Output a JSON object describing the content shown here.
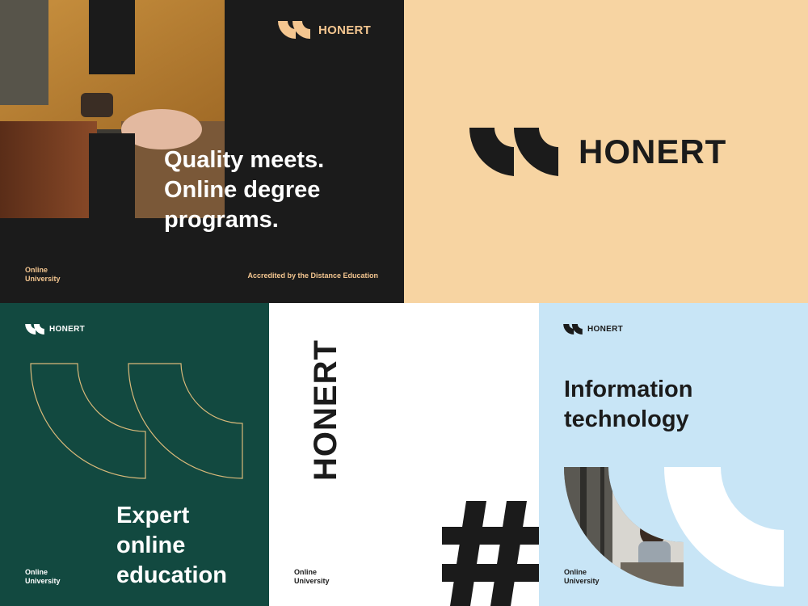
{
  "brand": {
    "name": "HONERT"
  },
  "panels": {
    "top_left": {
      "headline": [
        "Quality meets.",
        "Online degree",
        "programs."
      ],
      "footer_left": [
        "Online",
        "University"
      ],
      "footer_right": "Accredited by the Distance Education"
    },
    "top_right": {},
    "bottom_left": {
      "headline": [
        "Expert",
        "online",
        "education"
      ],
      "footer": [
        "Online",
        "University"
      ]
    },
    "bottom_center": {
      "vertical_word": "HONERT",
      "footer": [
        "Online",
        "University"
      ]
    },
    "bottom_right": {
      "headline": [
        "Information",
        "technology"
      ],
      "footer": [
        "Online",
        "University"
      ]
    }
  },
  "colors": {
    "dark": "#1b1b1b",
    "peach": "#f7d4a2",
    "green": "#124940",
    "white": "#ffffff",
    "light_blue": "#c8e5f6",
    "gold": "#d9b97a"
  }
}
